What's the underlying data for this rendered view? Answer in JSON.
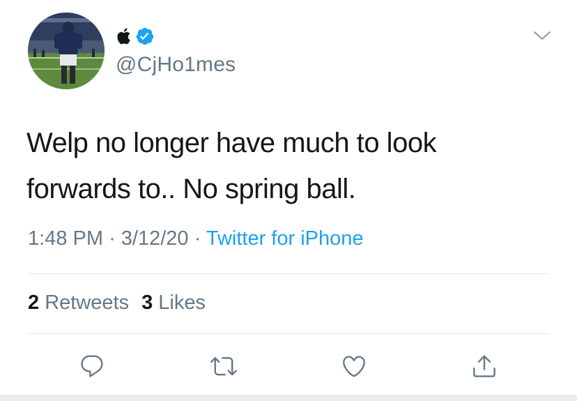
{
  "author": {
    "handle": "@CjHo1mes",
    "name_icons": [
      "apple-icon",
      "verified-icon"
    ],
    "verified": true
  },
  "tweet": {
    "text": "Welp no longer have much to look forwards to.. No spring ball."
  },
  "meta": {
    "time": "1:48 PM",
    "separator": "·",
    "date": "3/12/20",
    "source": "Twitter for iPhone"
  },
  "stats": {
    "retweets_count": "2",
    "retweets_label": "Retweets",
    "likes_count": "3",
    "likes_label": "Likes"
  },
  "actions": [
    "reply-icon",
    "retweet-icon",
    "like-icon",
    "share-icon"
  ],
  "colors": {
    "text": "#14171a",
    "secondary": "#657786",
    "link": "#1da1f2",
    "verified": "#1da1f2",
    "divider": "#e1e8ed"
  }
}
